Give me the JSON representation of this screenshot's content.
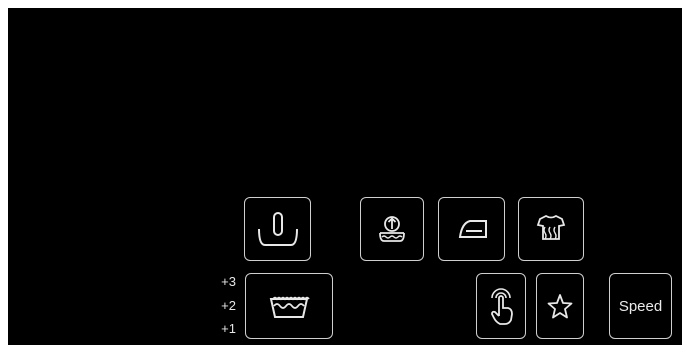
{
  "panel": {
    "accent": "#cfcfcf",
    "background": "#000000",
    "buttons": [
      {
        "name": "hand-wash-button",
        "icon": "hand-wash-icon"
      },
      {
        "name": "rinse-hold-button",
        "icon": "rinse-icon"
      },
      {
        "name": "easy-iron-button",
        "icon": "iron-icon"
      },
      {
        "name": "steam-button",
        "icon": "steam-shirt-icon"
      },
      {
        "name": "soil-level-button",
        "icon": "basin-icon"
      },
      {
        "name": "touch-control-button",
        "icon": "touch-icon"
      },
      {
        "name": "favorite-button",
        "icon": "star-icon"
      },
      {
        "name": "speed-button",
        "icon": ""
      }
    ],
    "levels": {
      "plus3": "+3",
      "plus2": "+2",
      "plus1": "+1"
    },
    "speed_label": "Speed"
  }
}
